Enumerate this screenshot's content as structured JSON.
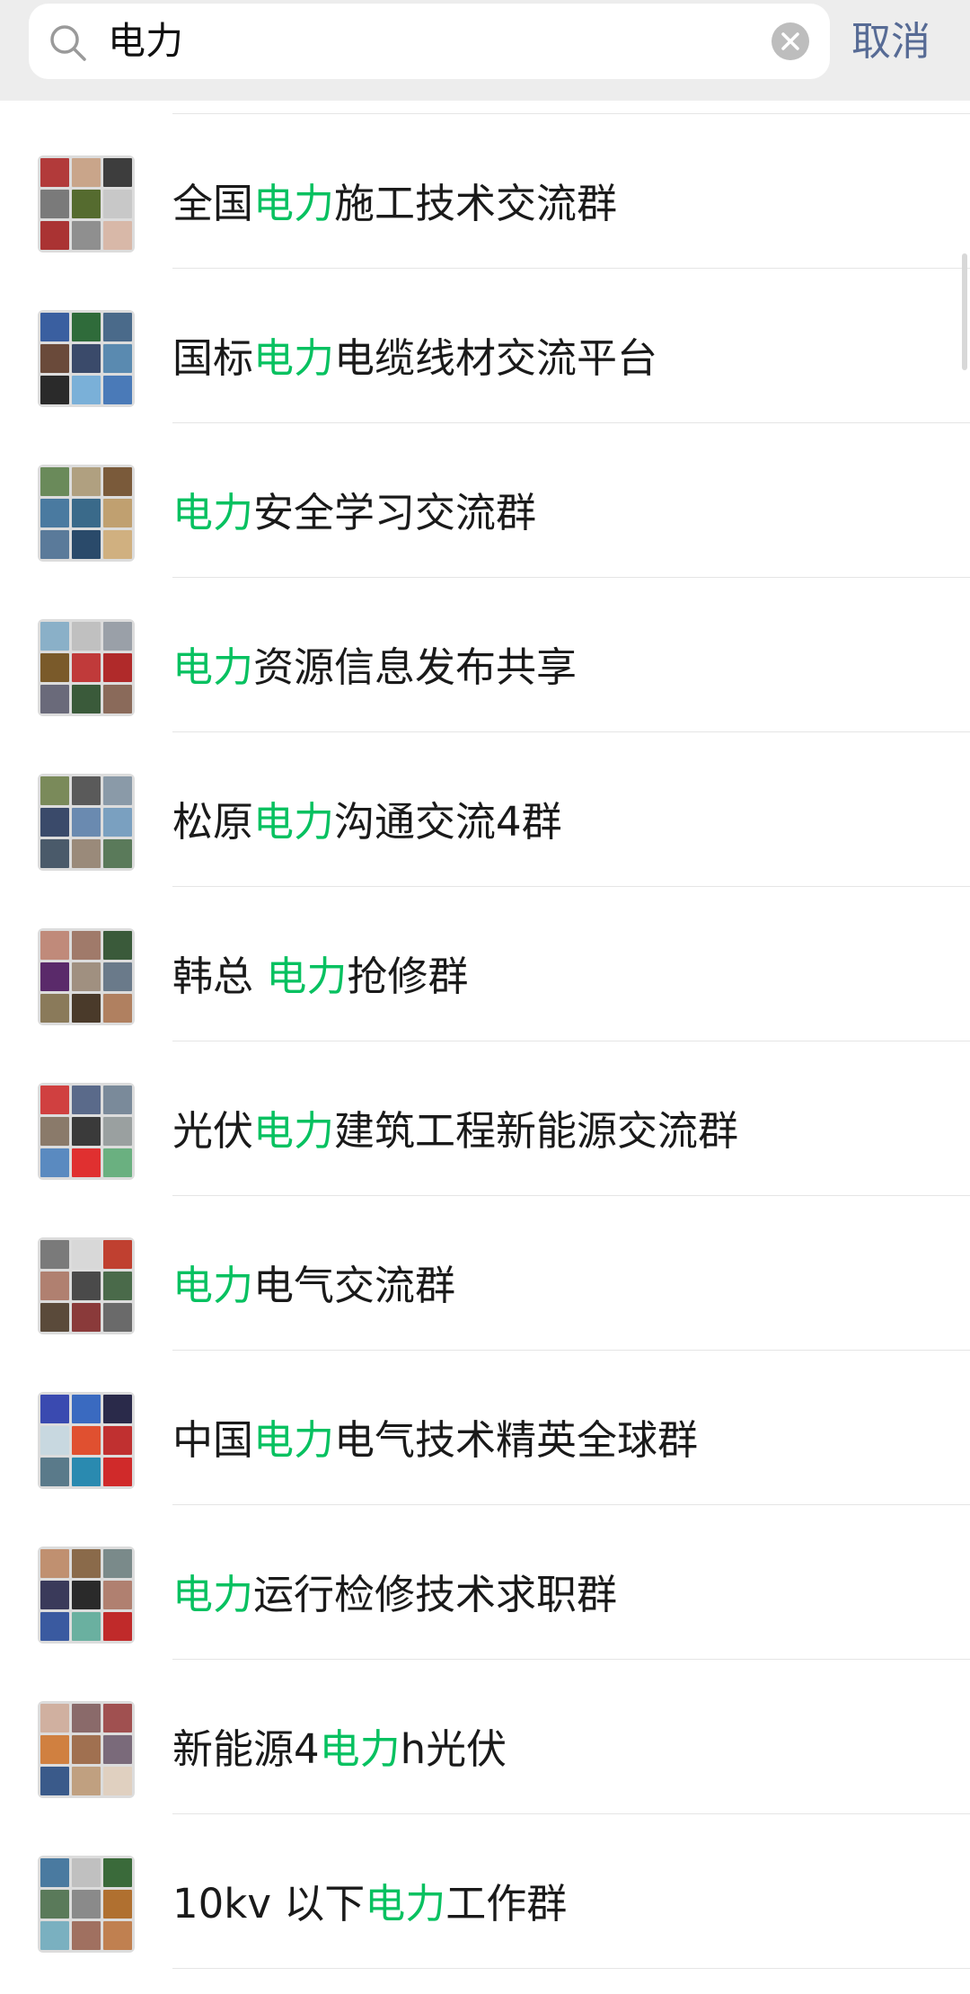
{
  "search": {
    "query": "电力",
    "cancel_label": "取消"
  },
  "colors": {
    "highlight": "#07c160",
    "cancel": "#576b95",
    "header_bg": "#ededed"
  },
  "results": [
    {
      "pre": "全国",
      "hl": "电力",
      "post": "施工技术交流群"
    },
    {
      "pre": "国标",
      "hl": "电力",
      "post": "电缆线材交流平台"
    },
    {
      "pre": "",
      "hl": "电力",
      "post": "安全学习交流群"
    },
    {
      "pre": "",
      "hl": "电力",
      "post": "资源信息发布共享"
    },
    {
      "pre": "松原",
      "hl": "电力",
      "post": "沟通交流4群"
    },
    {
      "pre": "韩总 ",
      "hl": "电力",
      "post": "抢修群"
    },
    {
      "pre": "光伏",
      "hl": "电力",
      "post": "建筑工程新能源交流群"
    },
    {
      "pre": "",
      "hl": "电力",
      "post": "电气交流群"
    },
    {
      "pre": "中国",
      "hl": "电力",
      "post": "电气技术精英全球群"
    },
    {
      "pre": "",
      "hl": "电力",
      "post": "运行检修技术求职群"
    },
    {
      "pre": "新能源4",
      "hl": "电力",
      "post": "h光伏"
    },
    {
      "pre": "10kv 以下",
      "hl": "电力",
      "post": "工作群"
    }
  ]
}
